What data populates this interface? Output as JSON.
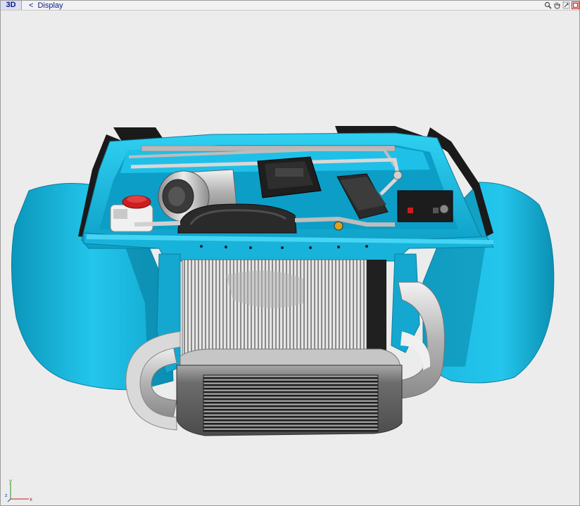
{
  "toolbar": {
    "mode_tab": "3D",
    "back_glyph": "<",
    "nav_label": "Display",
    "icons": [
      "zoom-icon",
      "pan-hand-icon",
      "rotate-icon",
      "close-icon"
    ]
  },
  "axes": {
    "x": "x",
    "y": "y",
    "z": "z"
  },
  "colors": {
    "body_blue": "#13b7de",
    "body_dark": "#0a7fa0",
    "chrome": "#c9c9c9",
    "metal_dark": "#4a4a4a",
    "background": "#ececec",
    "accent_red": "#cc1e1e"
  }
}
